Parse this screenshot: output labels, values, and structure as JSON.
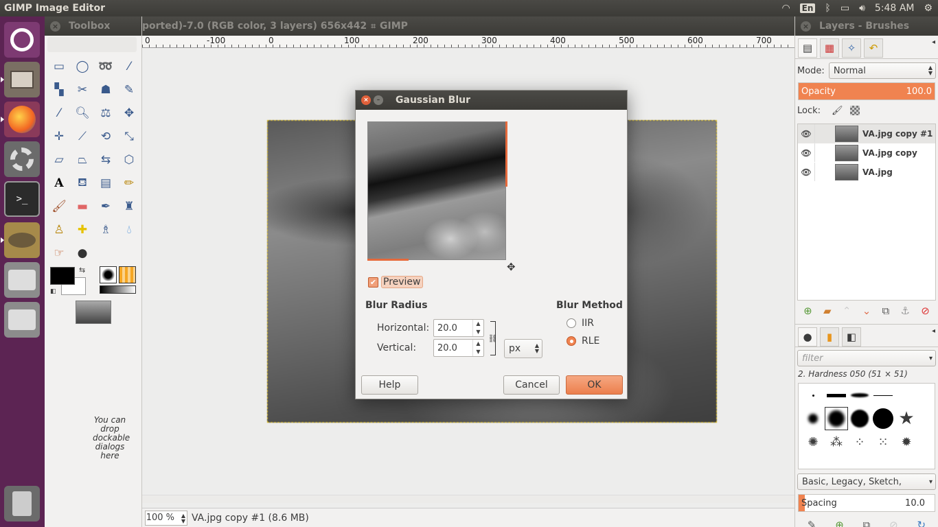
{
  "topbar": {
    "app_title": "GIMP Image Editor",
    "keyboard_layout": "En",
    "clock": "5:48 AM"
  },
  "launcher": {
    "items": [
      "ubuntu-dash-icon",
      "files-icon",
      "firefox-icon",
      "system-settings-icon",
      "terminal-icon",
      "gimp-icon",
      "drive-icon",
      "drive-icon",
      "trash-icon"
    ]
  },
  "toolbox": {
    "title": "Toolbox",
    "drop_hint": "You can drop dockable dialogs here"
  },
  "image_window": {
    "title": "ported)-7.0 (RGB color, 3 layers) 656x442",
    "app_label": "GIMP",
    "ruler_labels": [
      "0",
      "-100",
      "0",
      "100",
      "200",
      "300",
      "400",
      "500",
      "600",
      "700"
    ],
    "zoom": "100 %",
    "status": "VA.jpg copy #1 (8.6 MB)"
  },
  "dock": {
    "title": "Layers - Brushes",
    "mode_label": "Mode:",
    "mode_value": "Normal",
    "opacity_label": "Opacity",
    "opacity_value": "100.0",
    "lock_label": "Lock:",
    "layers": [
      {
        "name": "VA.jpg copy #1"
      },
      {
        "name": "VA.jpg copy"
      },
      {
        "name": "VA.jpg"
      }
    ],
    "filter_placeholder": "filter",
    "brush_name": "2. Hardness 050 (51 × 51)",
    "brush_tags": "Basic, Legacy, Sketch,",
    "spacing_label": "Spacing",
    "spacing_value": "10.0"
  },
  "dialog": {
    "title": "Gaussian Blur",
    "preview_label": "Preview",
    "blur_radius_label": "Blur Radius",
    "horizontal_label": "Horizontal:",
    "horizontal_value": "20.0",
    "vertical_label": "Vertical:",
    "vertical_value": "20.0",
    "unit": "px",
    "blur_method_label": "Blur Method",
    "method_options": [
      "IIR",
      "RLE"
    ],
    "method_selected": "RLE",
    "help": "Help",
    "cancel": "Cancel",
    "ok": "OK"
  },
  "colors": {
    "accent": "#f08350",
    "launcher_bg": "#5c2453",
    "panel_bg": "#3c3b37"
  }
}
